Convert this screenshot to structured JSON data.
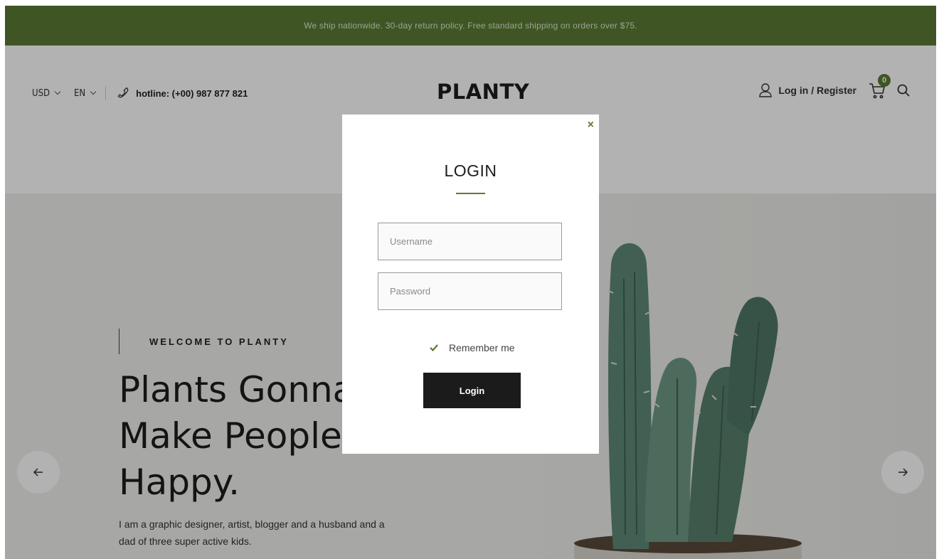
{
  "announcement": {
    "text": "We ship nationwide. 30-day return policy. Free standard shipping on orders over $75."
  },
  "header": {
    "currency": "USD",
    "language": "EN",
    "hotline": "hotline: (+00) 987 877 821",
    "logo": "PLANTY",
    "login_register": "Log in / Register",
    "cart_count": "0",
    "icons": [
      "phone-icon",
      "user-icon",
      "cart-icon",
      "search-icon"
    ]
  },
  "hero": {
    "eyebrow": "WELCOME TO PLANTY",
    "headline": "Plants Gonna Make People Happy.",
    "description": "I am a graphic designer, artist, blogger and a husband and a dad of three super active kids.",
    "prev_icon": "arrow-left-icon",
    "next_icon": "arrow-right-icon"
  },
  "login_modal": {
    "close": "×",
    "title": "LOGIN",
    "username_placeholder": "Username",
    "password_placeholder": "Password",
    "remember_label": "Remember me",
    "remember_checked": true,
    "submit_label": "Login"
  },
  "colors": {
    "brand_green": "#5c7a34",
    "button_dark": "#1b1b1b"
  }
}
